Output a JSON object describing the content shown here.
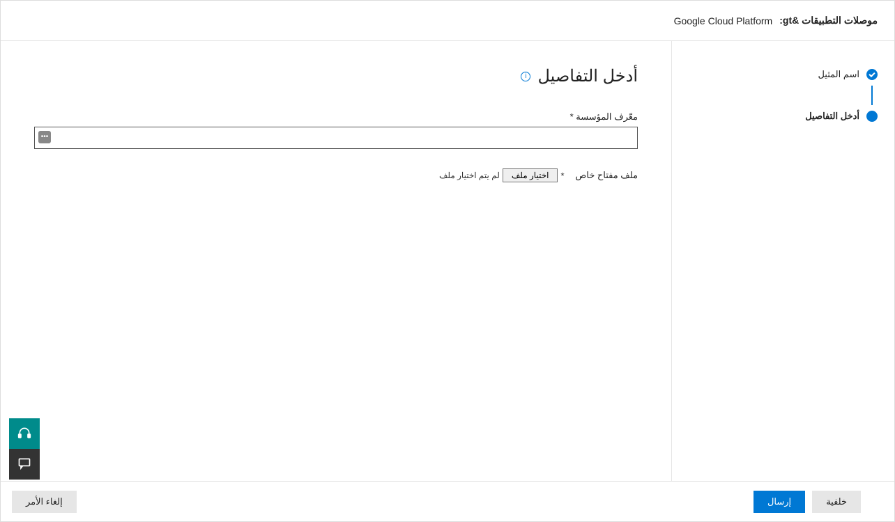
{
  "header": {
    "breadcrumb_prefix": "موصلات التطبيقات &gt:",
    "breadcrumb_current": "Google Cloud Platform"
  },
  "sidebar": {
    "steps": [
      {
        "label": "اسم المثيل",
        "completed": true
      },
      {
        "label": "أدخل التفاصيل",
        "completed": false,
        "active": true
      }
    ]
  },
  "main": {
    "heading": "أدخل التفاصيل",
    "org_id_label": "معّرف المؤسسة *",
    "org_id_value": "",
    "private_key_label": "ملف مفتاح خاص",
    "file_required_mark": "*",
    "file_choose_btn": "اختيار ملف",
    "file_none_chosen": "لم يتم اختيار ملف"
  },
  "footer": {
    "back": "خلفية",
    "submit": "إرسال",
    "cancel": "إلغاء الأمر"
  }
}
